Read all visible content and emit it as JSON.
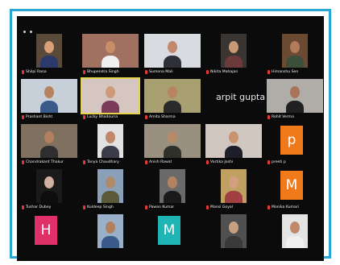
{
  "meeting": {
    "tiles": [
      {
        "id": "r1c1",
        "label": "Shilpi Rana",
        "color": "#5a4a3a",
        "skin": "#d9a07a",
        "shirt": "#2b3a6b"
      },
      {
        "id": "r1c2",
        "label": "Bhupendra Singh",
        "color": "#a07060",
        "skin": "#c88e68",
        "shirt": "#f0f0f0"
      },
      {
        "id": "r1c3",
        "label": "Sumona Mali",
        "color": "#d8dce0",
        "skin": "#c18a6a",
        "shirt": "#2f2f3a"
      },
      {
        "id": "r1c4",
        "label": "Nikita Mahajan",
        "color": "#3a3530",
        "skin": "#c89a78",
        "shirt": "#6b3b3b"
      },
      {
        "id": "r1c5",
        "label": "Himanshu Sen",
        "color": "#6b4a32",
        "skin": "#b27c5a",
        "shirt": "#3b4f3a"
      },
      {
        "id": "r2c1",
        "label": "Prashant Bisht",
        "color": "#c7d0d8",
        "skin": "#b9825f",
        "shirt": "#3a5a8a"
      },
      {
        "id": "r2c2",
        "label": "Lucky Bhadouria",
        "color": "#d5c6c2",
        "skin": "#cf9a7a",
        "shirt": "#7a3a5a",
        "active": true
      },
      {
        "id": "r2c3",
        "label": "Amita Sharma",
        "color": "#a8a070",
        "skin": "#b88460",
        "shirt": "#2a2a2a"
      },
      {
        "id": "r2c4",
        "label": "arpit gupta",
        "type": "text"
      },
      {
        "id": "r2c5",
        "label": "Rohit Verma",
        "color": "#b0aca8",
        "skin": "#a7745a",
        "shirt": "#202020"
      },
      {
        "id": "r3c1",
        "label": "Chandrakant Thakur",
        "color": "#807060",
        "skin": "#b2805e",
        "shirt": "#2e2e2e"
      },
      {
        "id": "r3c2",
        "label": "Tanya Chaudhary",
        "color": "#e2e2e2",
        "skin": "#c0886a",
        "shirt": "#3b3b4a"
      },
      {
        "id": "r3c3",
        "label": "Anish Rawat",
        "color": "#9a9080",
        "skin": "#b98a68",
        "shirt": "#30302a"
      },
      {
        "id": "r3c4",
        "label": "Vartika Joshi",
        "color": "#d0c8c0",
        "skin": "#c8936f",
        "shirt": "#1e1e2a"
      },
      {
        "id": "r3c5",
        "label": "p",
        "sub": "preeti p",
        "type": "avatar",
        "avatar_color": "#f07a1a"
      },
      {
        "id": "r4c1",
        "label": "Tushar Dubey",
        "color": "#1a1a1a",
        "skin": "#d0b0a0",
        "shirt": "#0e0e0e"
      },
      {
        "id": "r4c2",
        "label": "Kuldeep Singh",
        "color": "#8aa0b8",
        "skin": "#b08a68",
        "shirt": "#5a5a3a"
      },
      {
        "id": "r4c3",
        "label": "Pawan Kumar",
        "color": "#6a6a6a",
        "skin": "#b38260",
        "shirt": "#1a1a1a"
      },
      {
        "id": "r4c4",
        "label": "Mansi Goyal",
        "color": "#c0a060",
        "skin": "#d0a080",
        "shirt": "#a04040"
      },
      {
        "id": "r4c5",
        "label": "M",
        "sub": "Monika Kumari",
        "type": "avatar",
        "avatar_color": "#f07a1a"
      },
      {
        "id": "r5c1",
        "label": "H",
        "type": "avatar",
        "avatar_color": "#e0306a"
      },
      {
        "id": "r5c2",
        "label": "",
        "color": "#9ab0c8",
        "skin": "#b08060",
        "shirt": "#3a5a8a"
      },
      {
        "id": "r5c3",
        "label": "M",
        "type": "avatar",
        "avatar_color": "#1fb5b5"
      },
      {
        "id": "r5c4",
        "label": "",
        "color": "#505050",
        "skin": "#c8a080",
        "shirt": "#3a3a3a"
      },
      {
        "id": "r5c5",
        "label": "",
        "color": "#e4e4e4",
        "skin": "#c08868",
        "shirt": "#f0f0f0"
      }
    ]
  }
}
